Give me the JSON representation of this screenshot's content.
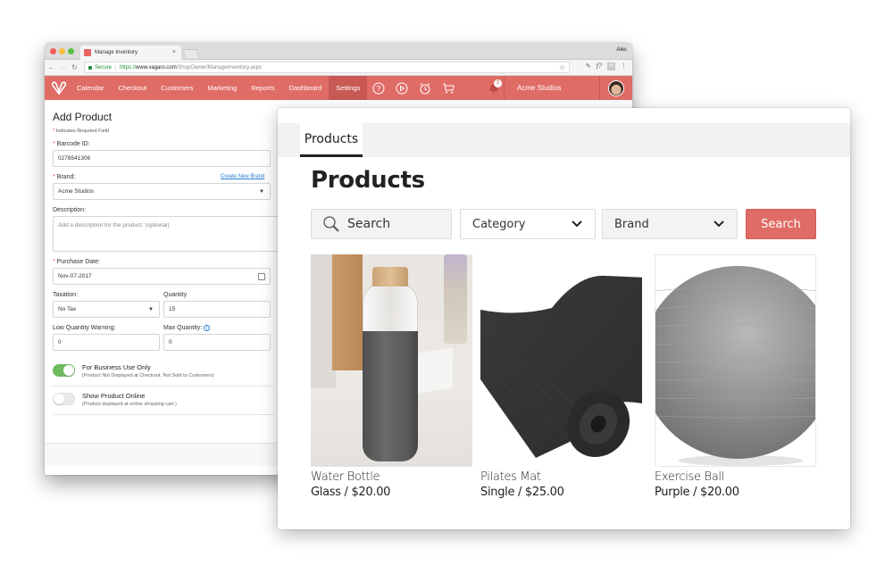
{
  "browser": {
    "tab_title": "Manage Inventory",
    "profile_name": "Alec",
    "secure_label": "Secure",
    "url_proto": "https://",
    "url_host": "www.vagaro.com",
    "url_path": "/ShopOwner/ManageInventory.aspx"
  },
  "appbar": {
    "nav": [
      "Calendar",
      "Checkout",
      "Customers",
      "Marketing",
      "Reports",
      "Dashboard",
      "Settings"
    ],
    "active": "Settings",
    "notification_count": "3",
    "business_name": "Acme Studios"
  },
  "form": {
    "title": "Add Product",
    "required_note": "Indicates Required Field",
    "barcode": {
      "label": "Barcode ID:",
      "value": "0278541306"
    },
    "brand": {
      "label": "Brand:",
      "value": "Acme Studios",
      "create_link": "Create New Brand"
    },
    "description": {
      "label": "Description:",
      "placeholder": "Add a description for the product. (optional)"
    },
    "purchase_date": {
      "label": "Purchase Date:",
      "value": "Nov-07-2017"
    },
    "taxation": {
      "label": "Taxation:",
      "value": "No Tax"
    },
    "quantity": {
      "label": "Quantity",
      "value": "15"
    },
    "low_quantity": {
      "label": "Low Quantity Warning:",
      "value": "0"
    },
    "max_quantity": {
      "label": "Max Quantity:",
      "value": "0"
    },
    "business_use": {
      "title": "For Business Use Only",
      "subtitle": "(Product Not Displayed at Checkout, Not Sold to Customers)",
      "on": true
    },
    "show_online": {
      "title": "Show Product Online",
      "subtitle": "(Product displayed at online shopping cart.)",
      "on": false
    }
  },
  "products_panel": {
    "tab_label": "Products",
    "title": "Products",
    "search_placeholder": "Search",
    "category_label": "Category",
    "brand_label": "Brand",
    "search_button": "Search",
    "accent_color": "#e06c66",
    "items": [
      {
        "name": "Water Bottle",
        "variant": "Glass / $20.00"
      },
      {
        "name": "Pilates Mat",
        "variant": "Single / $25.00"
      },
      {
        "name": "Exercise Ball",
        "variant": "Purple / $20.00"
      }
    ]
  }
}
